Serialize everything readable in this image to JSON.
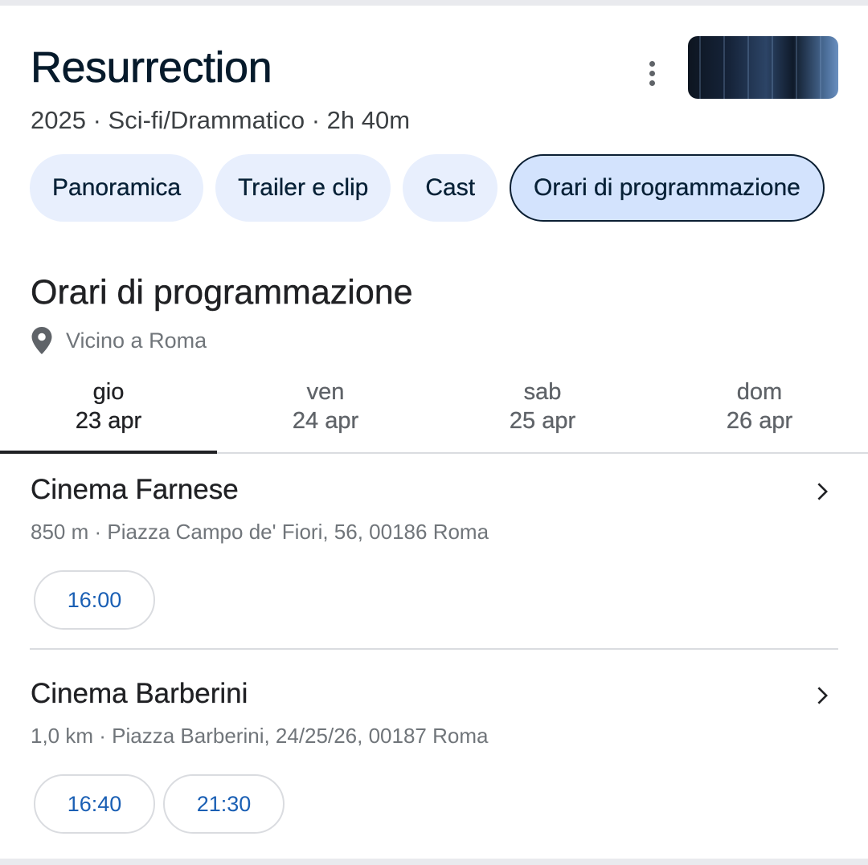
{
  "movie": {
    "title": "Resurrection",
    "meta": "2025 · Sci-fi/Drammatico · 2h 40m"
  },
  "tabs": [
    {
      "label": "Panoramica",
      "active": false
    },
    {
      "label": "Trailer e clip",
      "active": false
    },
    {
      "label": "Cast",
      "active": false
    },
    {
      "label": "Orari di programmazione",
      "active": true
    }
  ],
  "showtimes": {
    "title": "Orari di programmazione",
    "location": "Vicino a Roma",
    "days": [
      {
        "name": "gio",
        "date": "23 apr",
        "active": true
      },
      {
        "name": "ven",
        "date": "24 apr",
        "active": false
      },
      {
        "name": "sab",
        "date": "25 apr",
        "active": false
      },
      {
        "name": "dom",
        "date": "26 apr",
        "active": false
      }
    ],
    "theaters": [
      {
        "name": "Cinema Farnese",
        "distance": "850 m",
        "address": "Piazza Campo de' Fiori, 56, 00186 Roma",
        "times": [
          "16:00"
        ]
      },
      {
        "name": "Cinema Barberini",
        "distance": "1,0 km",
        "address": "Piazza Barberini, 24/25/26, 00187 Roma",
        "times": [
          "16:40",
          "21:30"
        ]
      }
    ]
  },
  "icons": {
    "more": "more-vert-icon",
    "location": "location-pin-icon",
    "chevron": "chevron-right-icon"
  },
  "colors": {
    "chip_bg": "#e8effd",
    "chip_active_bg": "#d3e3fd",
    "time_text": "#1a5fb4"
  }
}
